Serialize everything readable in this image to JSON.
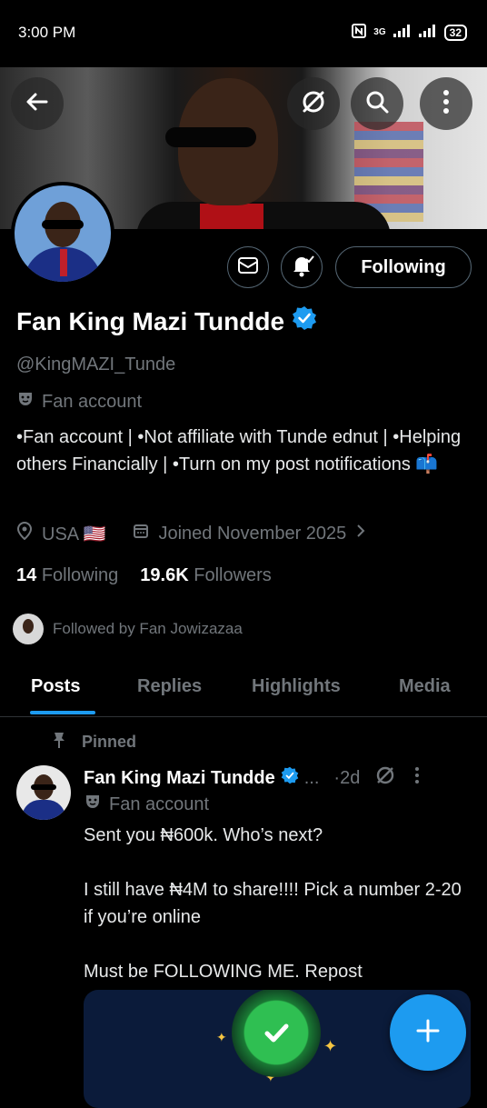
{
  "status_bar": {
    "time": "3:00 PM",
    "network": "3G",
    "battery": "32"
  },
  "profile": {
    "name": "Fan King Mazi Tundde",
    "handle": "@KingMAZI_Tunde",
    "label": "Fan account",
    "bio": "•Fan account |  •Not affiliate with Tunde ednut | •Helping others Financially | •Turn on my post notifications 📫",
    "location": "USA 🇺🇸",
    "joined": "Joined November 2025",
    "following_count": "14",
    "following_label": "Following",
    "followers_count": "19.6K",
    "followers_label": "Followers",
    "followed_by": "Followed by Fan Jowizazaa",
    "follow_button": "Following"
  },
  "tabs": [
    "Posts",
    "Replies",
    "Highlights",
    "Media"
  ],
  "post": {
    "pinned_label": "Pinned",
    "author": "Fan King Mazi Tundde",
    "ellipsis": "...",
    "time": "·2d",
    "label": "Fan account",
    "text": "Sent you ₦600k. Who’s next?\n\nI still have ₦4M to share!!!! Pick a number 2-20 if you’re online\n\nMust be FOLLOWING ME. Repost"
  },
  "icons": {
    "verified_color": "#1d9bf0",
    "accent": "#1d9bf0"
  }
}
